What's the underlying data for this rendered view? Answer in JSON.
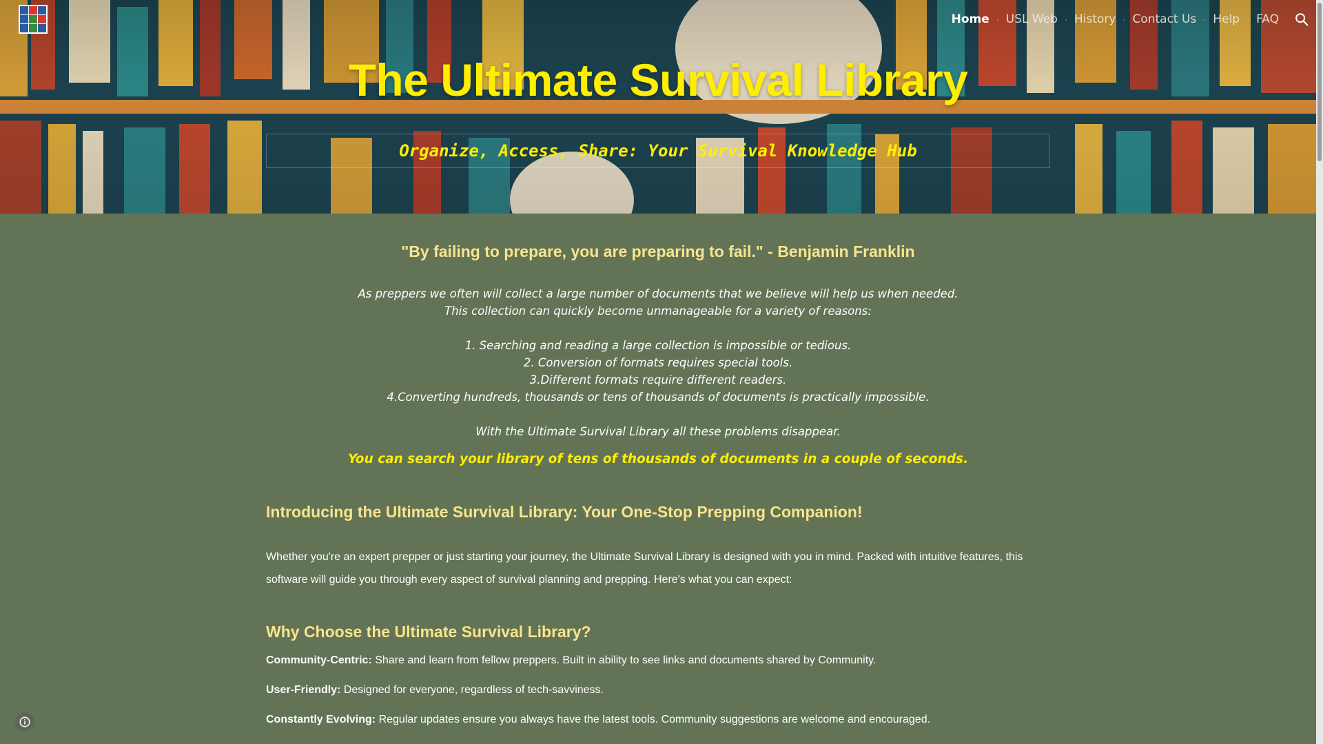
{
  "nav": {
    "items": [
      {
        "label": "Home",
        "active": true
      },
      {
        "label": "USL Web",
        "active": false
      },
      {
        "label": "History",
        "active": false
      },
      {
        "label": "Contact Us",
        "active": false
      },
      {
        "label": "Help",
        "active": false
      },
      {
        "label": "FAQ",
        "active": false
      }
    ],
    "search_icon": "search-icon"
  },
  "hero": {
    "title": "The Ultimate Survival Library",
    "tagline": "Organize, Access, Share: Your Survival Knowledge Hub"
  },
  "main": {
    "quote": "\"By failing to prepare, you are preparing to fail.\" - Benjamin Franklin",
    "intro_lines": [
      "As preppers we often will collect a large number of documents that we believe will help us when needed.",
      "This collection can quickly become unmanageable for  a variety of reasons:",
      "",
      "1. Searching and reading a large collection is impossible or tedious.",
      "2. Conversion of formats requires special tools.",
      "3.Different formats require different readers.",
      "4.Converting hundreds, thousands or tens of thousands of documents is practically impossible.",
      "",
      "With the Ultimate Survival Library all these problems disappear."
    ],
    "highlight": "You can search your library of tens of thousands of documents in a couple of seconds.",
    "section1_title": "Introducing the Ultimate Survival Library: Your One-Stop Prepping Companion!",
    "section1_paragraph": "Whether you're an expert prepper or just starting your journey, the Ultimate Survival Library is designed with you in mind. Packed with intuitive features, this software will guide you through every aspect of survival planning and prepping. Here's what you can expect:",
    "section2_title": "Why Choose the Ultimate Survival Library?",
    "features": [
      {
        "label": "Community-Centric:",
        "text": " Share and learn from fellow preppers. Built in ability to see links and documents shared by Community."
      },
      {
        "label": "User-Friendly:",
        "text": " Designed for everyone, regardless of tech-savviness."
      },
      {
        "label": "Constantly Evolving:",
        "text": " Regular updates ensure you always have the latest tools. Community suggestions are welcome and encouraged."
      }
    ]
  },
  "footer": {
    "info_icon": "info-icon"
  },
  "colors": {
    "background": "#627356",
    "title_yellow": "#ffee00",
    "heading_gold": "#f9e58c"
  }
}
